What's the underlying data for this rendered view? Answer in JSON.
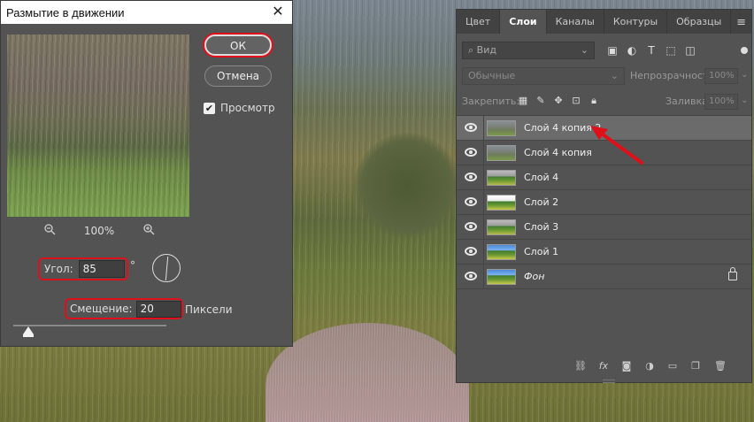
{
  "dialog": {
    "title": "Размытие в движении",
    "ok_label": "ОК",
    "cancel_label": "Отмена",
    "preview_label": "Просмотр",
    "preview_checked": true,
    "zoom_level": "100%",
    "angle_label": "Угол:",
    "angle_value": "85",
    "angle_unit": "°",
    "distance_label": "Смещение:",
    "distance_value": "20",
    "distance_unit": "Пиксели"
  },
  "panel": {
    "tabs": [
      "Цвет",
      "Слои",
      "Каналы",
      "Контуры",
      "Образцы"
    ],
    "active_tab": "Слои",
    "search_placeholder": "Вид",
    "blend_mode": "Обычные",
    "opacity_label": "Непрозрачность:",
    "opacity_value": "100%",
    "lock_label": "Закрепить:",
    "fill_label": "Заливка:",
    "fill_value": "100%",
    "layers": [
      {
        "name": "Слой 4 копия 2",
        "selected": true
      },
      {
        "name": "Слой 4 копия",
        "selected": false
      },
      {
        "name": "Слой 4",
        "selected": false
      },
      {
        "name": "Слой 2",
        "selected": false
      },
      {
        "name": "Слой 3",
        "selected": false
      },
      {
        "name": "Слой 1",
        "selected": false
      },
      {
        "name": "Фон",
        "selected": false,
        "locked": true
      }
    ]
  },
  "colors": {
    "highlight": "#e0101a",
    "panel_bg": "#535353",
    "selected_row": "#6b6b6b"
  }
}
